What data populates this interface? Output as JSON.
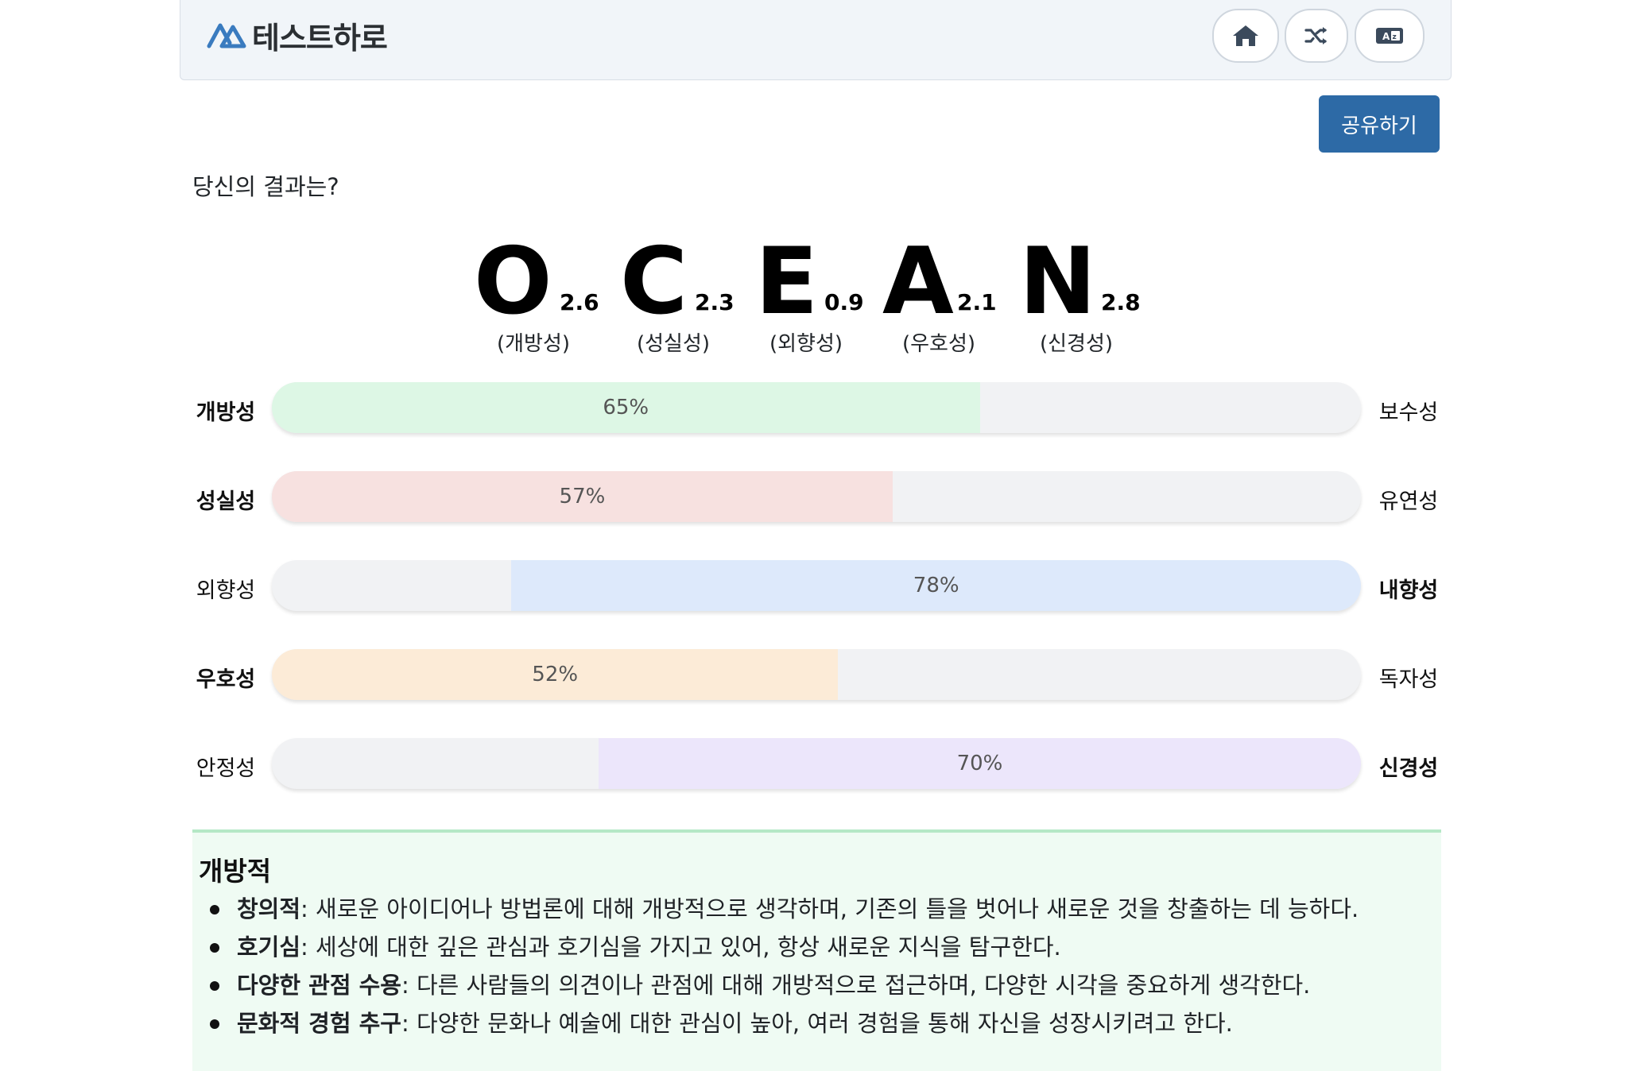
{
  "header": {
    "brand_name": "테스트하로",
    "buttons": [
      {
        "name": "home",
        "icon": "home-icon"
      },
      {
        "name": "random",
        "icon": "shuffle-icon"
      },
      {
        "name": "language",
        "icon": "translate-icon"
      }
    ]
  },
  "share_label": "공유하기",
  "result_question": "당신의 결과는?",
  "ocean": [
    {
      "letter": "O",
      "score": "2.6",
      "trait": "(개방성)"
    },
    {
      "letter": "C",
      "score": "2.3",
      "trait": "(성실성)"
    },
    {
      "letter": "E",
      "score": "0.9",
      "trait": "(외향성)"
    },
    {
      "letter": "A",
      "score": "2.1",
      "trait": "(우호성)"
    },
    {
      "letter": "N",
      "score": "2.8",
      "trait": "(신경성)"
    }
  ],
  "bars": [
    {
      "left": "개방성",
      "right": "보수성",
      "percent_label": "65%",
      "percent": 65,
      "direction": "left",
      "color": "#ddf7e5"
    },
    {
      "left": "성실성",
      "right": "유연성",
      "percent_label": "57%",
      "percent": 57,
      "direction": "left",
      "color": "#f7e1e0"
    },
    {
      "left": "외향성",
      "right": "내향성",
      "percent_label": "78%",
      "percent": 78,
      "direction": "right",
      "color": "#dde9fb"
    },
    {
      "left": "우호성",
      "right": "독자성",
      "percent_label": "52%",
      "percent": 52,
      "direction": "left",
      "color": "#fcebd7"
    },
    {
      "left": "안정성",
      "right": "신경성",
      "percent_label": "70%",
      "percent": 70,
      "direction": "right",
      "color": "#ece6fb"
    }
  ],
  "description": {
    "title": "개방적",
    "items": [
      {
        "term": "창의적",
        "text": ": 새로운 아이디어나 방법론에 대해 개방적으로 생각하며, 기존의 틀을 벗어나 새로운 것을 창출하는 데 능하다."
      },
      {
        "term": "호기심",
        "text": ": 세상에 대한 깊은 관심과 호기심을 가지고 있어, 항상 새로운 지식을 탐구한다."
      },
      {
        "term": "다양한 관점 수용",
        "text": ": 다른 사람들의 의견이나 관점에 대해 개방적으로 접근하며, 다양한 시각을 중요하게 생각한다."
      },
      {
        "term": "문화적 경험 추구",
        "text": ": 다양한 문화나 예술에 대한 관심이 높아, 여러 경험을 통해 자신을 성장시키려고 한다."
      }
    ]
  }
}
